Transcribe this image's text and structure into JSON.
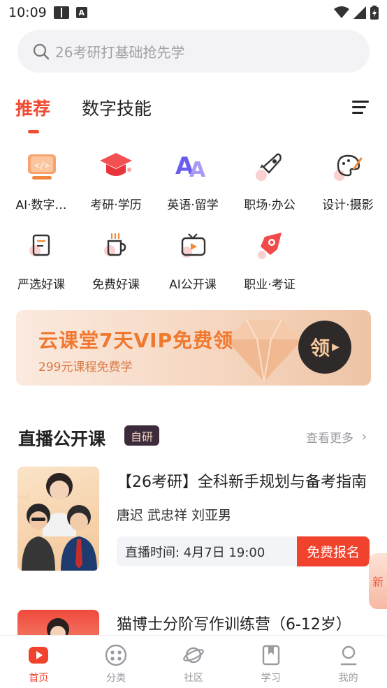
{
  "status_bar": {
    "time": "10:09",
    "letter_icon": "A"
  },
  "search": {
    "placeholder": "26考研打基础抢先学"
  },
  "tabs": {
    "active": "推荐",
    "second": "数字技能"
  },
  "categories": [
    {
      "label": "AI·数字…",
      "icon": "code-screen-icon"
    },
    {
      "label": "考研·学历",
      "icon": "graduation-cap-icon"
    },
    {
      "label": "英语·留学",
      "icon": "letters-aa-icon"
    },
    {
      "label": "职场·办公",
      "icon": "rocket-icon"
    },
    {
      "label": "设计·摄影",
      "icon": "palette-icon"
    },
    {
      "label": "严选好课",
      "icon": "book-icon"
    },
    {
      "label": "免费好课",
      "icon": "coffee-cup-icon"
    },
    {
      "label": "AI公开课",
      "icon": "tv-play-icon"
    },
    {
      "label": "职业·考证",
      "icon": "certificate-icon"
    }
  ],
  "banner": {
    "title": "云课堂7天VIP免费领",
    "subtitle": "299元课程免费学",
    "button": "领"
  },
  "section": {
    "title": "直播公开课",
    "badge": "自研",
    "see_more": "查看更多"
  },
  "course1": {
    "title": "【26考研】全科新手规划与备考指南",
    "teachers": "唐迟 武忠祥 刘亚男",
    "time": "直播时间: 4月7日  19:00",
    "register": "免费报名",
    "thumb_watermark": "TEA"
  },
  "float_badge": "新",
  "course2": {
    "title": "猫博士分阶写作训练营（6-12岁）"
  },
  "bottom_nav": [
    {
      "label": "首页",
      "active": true
    },
    {
      "label": "分类",
      "active": false
    },
    {
      "label": "社区",
      "active": false
    },
    {
      "label": "学习",
      "active": false
    },
    {
      "label": "我的",
      "active": false
    }
  ],
  "colors": {
    "accent": "#f04a31",
    "banner_text": "#f0782f",
    "nav_inactive": "#9a9aa0"
  }
}
